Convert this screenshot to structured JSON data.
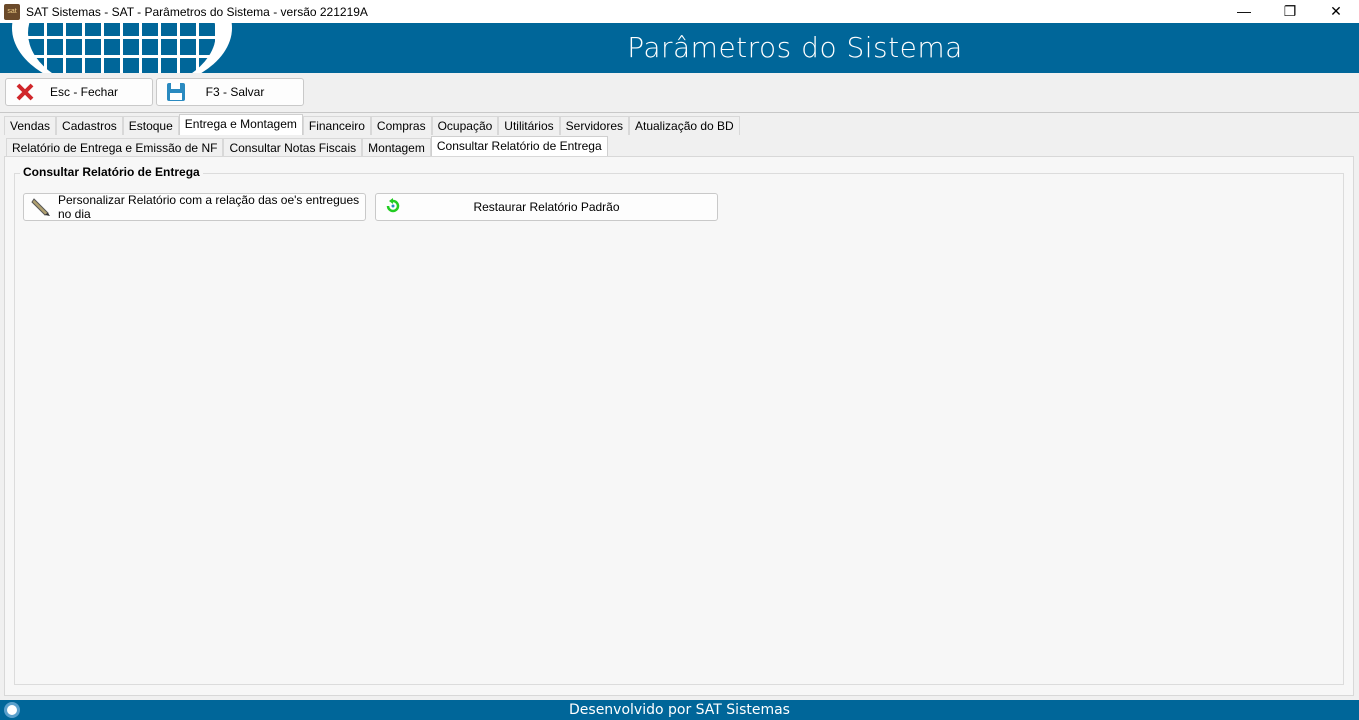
{
  "window": {
    "title": "SAT Sistemas - SAT - Parâmetros do Sistema - versão 221219A",
    "minimize": "—",
    "maximize": "❐",
    "close": "✕"
  },
  "banner": {
    "title": "Parâmetros do Sistema"
  },
  "toolbar": {
    "close_label": "Esc - Fechar",
    "save_label": "F3 - Salvar"
  },
  "main_tabs": [
    "Vendas",
    "Cadastros",
    "Estoque",
    "Entrega e Montagem",
    "Financeiro",
    "Compras",
    "Ocupação",
    "Utilitários",
    "Servidores",
    "Atualização do BD"
  ],
  "sub_tabs": [
    "Relatório de Entrega e Emissão de NF",
    "Consultar Notas Fiscais",
    "Montagem",
    "Consultar Relatório de Entrega"
  ],
  "group": {
    "title": "Consultar Relatório de Entrega",
    "customize_label": "Personalizar Relatório com a relação das oe's entregues no dia",
    "restore_label": "Restaurar Relatório Padrão"
  },
  "footer": {
    "text": "Desenvolvido por SAT Sistemas"
  }
}
